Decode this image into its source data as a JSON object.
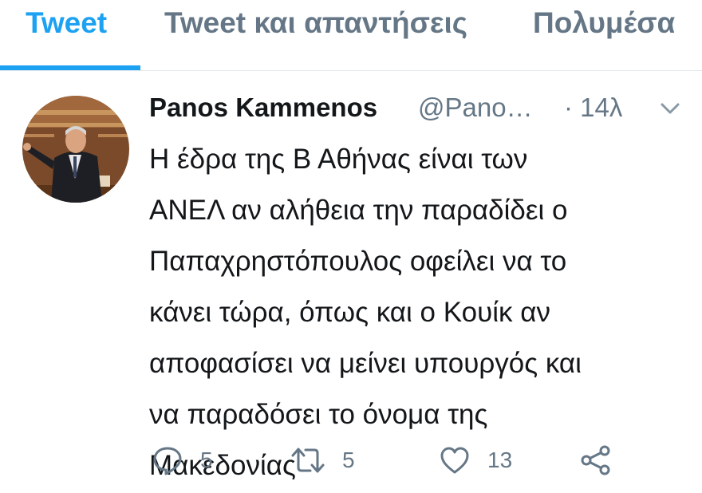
{
  "tabs": [
    {
      "label": "Tweet",
      "active": true
    },
    {
      "label": "Tweet και απαντήσεις",
      "active": false
    },
    {
      "label": "Πολυμέσα",
      "active": false
    }
  ],
  "tweet": {
    "author_name": "Panos Kammenos",
    "handle": "@Pano…",
    "time": "· 14λ",
    "text": "Η έδρα της Β Αθήνας είναι των\nΑΝΕΛ αν αλήθεια την παραδίδει ο\nΠαπαχρηστόπουλος οφείλει να το\nκάνει τώρα, όπως και ο Κουίκ αν\nαποφασίσει να μείνει υπουργός και\nνα παραδόσει το όνομα της\nΜακεδονίας",
    "replies": "5",
    "retweets": "5",
    "likes": "13"
  },
  "icons": [
    "chevron-down-icon",
    "reply-icon",
    "retweet-icon",
    "heart-icon",
    "share-icon"
  ],
  "colors": {
    "accent": "#1da1f2",
    "secondary_text": "#657786",
    "primary_text": "#14171a"
  }
}
